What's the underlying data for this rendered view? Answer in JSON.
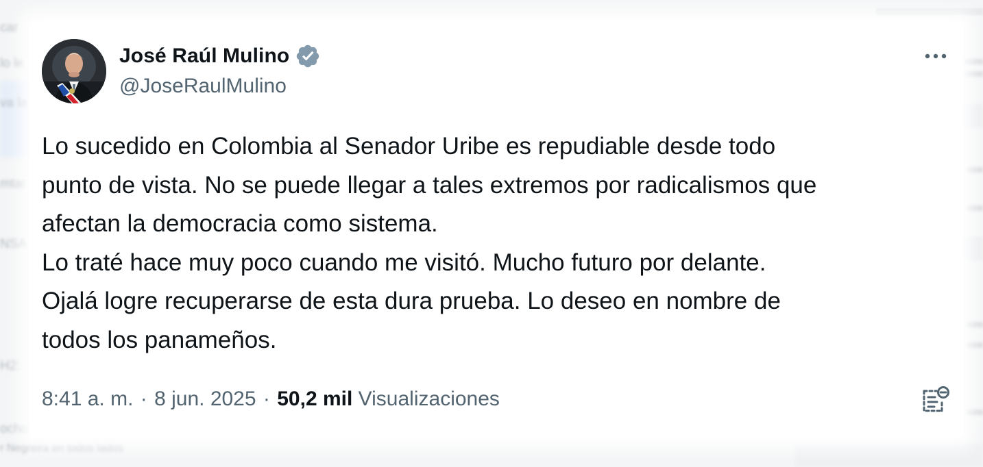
{
  "tweet": {
    "author": {
      "display_name": "José Raúl Mulino",
      "handle": "@JoseRaulMulino",
      "verified_icon": "verified-badge-icon",
      "verified_color": "#829aab"
    },
    "text_lines": [
      "Lo sucedido en Colombia al Senador Uribe es repudiable desde todo",
      "punto de vista. No se puede llegar a tales extremos por radicalismos que",
      "afectan la democracia como sistema.",
      "Lo traté hace muy poco cuando me visitó. Mucho futuro por delante.",
      "Ojalá logre recuperarse de esta dura prueba. Lo deseo en nombre de",
      "todos los panameños."
    ],
    "meta": {
      "time": "8:41 a. m.",
      "separator": "·",
      "date": "8 jun. 2025",
      "views_count": "50,2 mil",
      "views_label": "Visualizaciones"
    },
    "icons": {
      "more": "more-horizontal-icon",
      "community_notes": "community-notes-icon"
    },
    "colors": {
      "text_primary": "#0f1419",
      "text_secondary": "#536471"
    }
  }
}
